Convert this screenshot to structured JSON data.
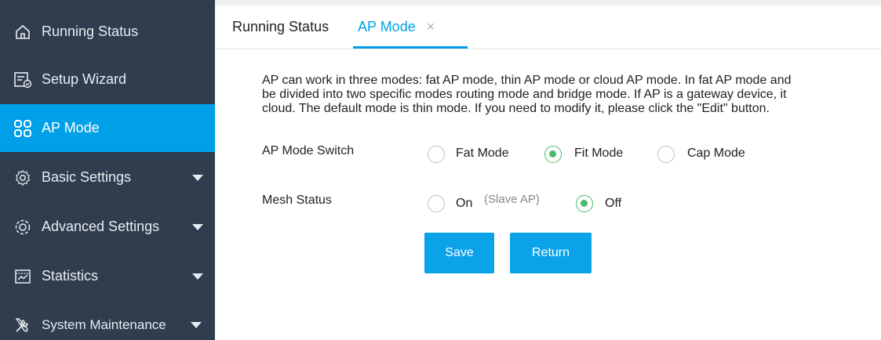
{
  "sidebar": {
    "items": [
      {
        "label": "Running Status",
        "icon": "home-icon",
        "active": false
      },
      {
        "label": "Setup Wizard",
        "icon": "wizard-icon",
        "active": false
      },
      {
        "label": "AP Mode",
        "icon": "grid-icon",
        "active": true
      },
      {
        "label": "Basic Settings",
        "icon": "gear-icon",
        "active": false
      },
      {
        "label": "Advanced Settings",
        "icon": "gear-advanced-icon",
        "active": false
      },
      {
        "label": "Statistics",
        "icon": "chart-icon",
        "active": false
      },
      {
        "label": "System Maintenance",
        "icon": "tools-icon",
        "active": false
      }
    ]
  },
  "tabs": [
    {
      "label": "Running Status",
      "active": false
    },
    {
      "label": "AP Mode",
      "active": true,
      "close": "×"
    }
  ],
  "description": {
    "line1": "AP can work in three modes: fat AP mode, thin AP mode or cloud AP mode. In fat AP mode and",
    "line2": "be divided into two specific modes routing mode and bridge mode. If AP is a gateway device, it",
    "line3": "cloud. The default mode is thin mode. If you need to modify it, please click the \"Edit\" button."
  },
  "ap_mode_switch": {
    "label": "AP Mode Switch",
    "options": [
      "Fat Mode",
      "Fit Mode",
      "Cap Mode"
    ],
    "selected": "Fit Mode"
  },
  "mesh_status": {
    "label": "Mesh Status",
    "on_label": "On",
    "on_hint": "(Slave AP)",
    "off_label": "Off",
    "selected": "Off"
  },
  "buttons": {
    "save": "Save",
    "return": "Return"
  },
  "colors": {
    "sidebar_bg": "#2f3d4f",
    "accent": "#00a0e9",
    "radio_checked": "#4cb96a"
  }
}
